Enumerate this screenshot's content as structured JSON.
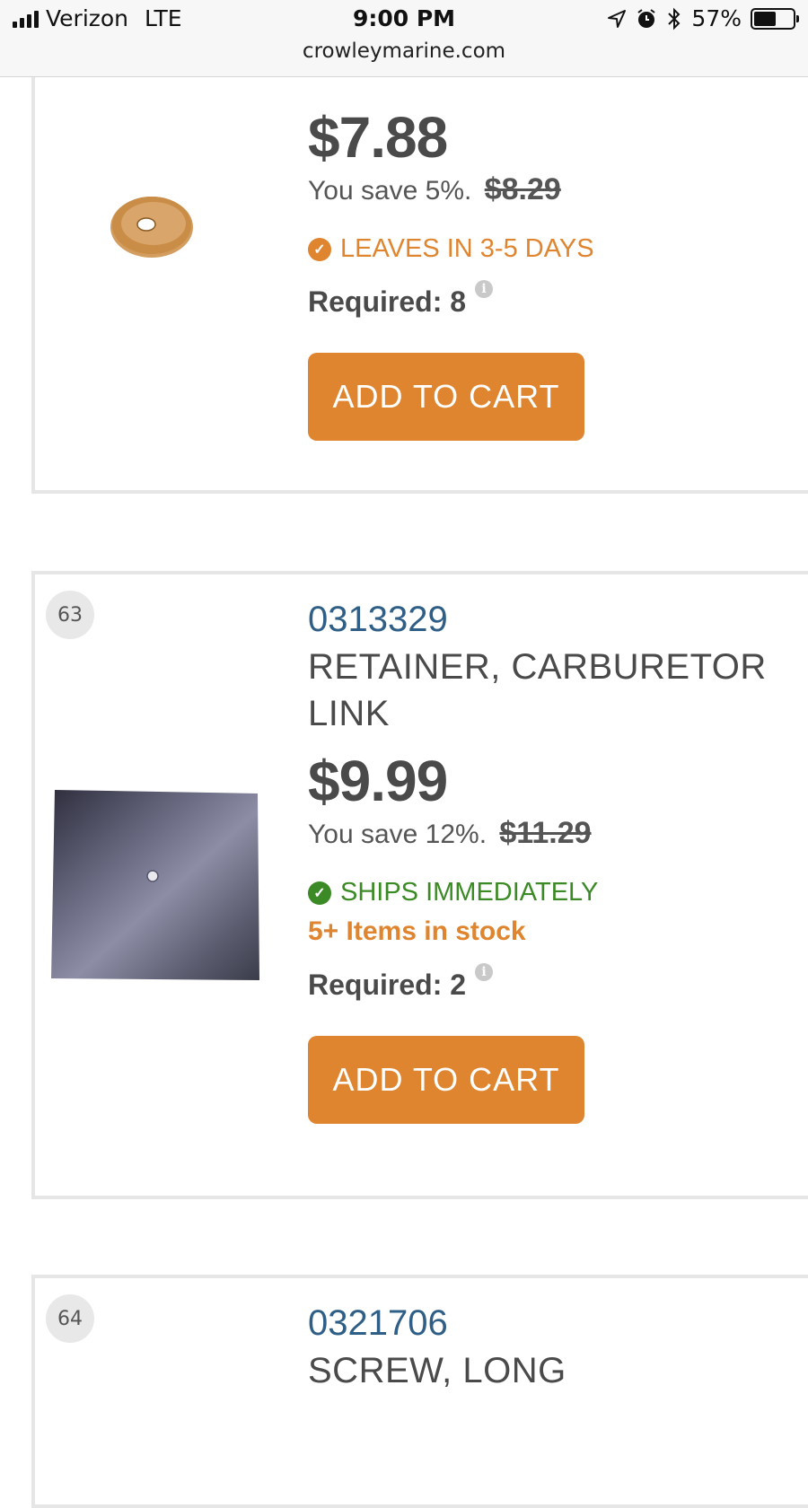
{
  "status_bar": {
    "carrier": "Verizon",
    "network": "LTE",
    "time": "9:00 PM",
    "battery": "57%",
    "battery_level": 0.57,
    "url": "crowleymarine.com"
  },
  "products": [
    {
      "price": "$7.88",
      "save_text": "You save 5%.",
      "old_price": "$8.29",
      "availability": "LEAVES IN 3-5 DAYS",
      "availability_color": "#e0852f",
      "required_label": "Required: 8",
      "cart_label": "ADD TO CART"
    },
    {
      "number": "63",
      "part_number": "0313329",
      "name": "RETAINER, CARBURETOR LINK",
      "price": "$9.99",
      "save_text": "You save 12%.",
      "old_price": "$11.29",
      "availability": "SHIPS IMMEDIATELY",
      "availability_color": "#3c8a26",
      "stock": "5+ Items in stock",
      "required_label": "Required: 2",
      "cart_label": "ADD TO CART"
    },
    {
      "number": "64",
      "part_number": "0321706",
      "name": "SCREW, LONG"
    }
  ],
  "icons": {
    "check": "check-circle-icon",
    "info": "info-icon"
  }
}
